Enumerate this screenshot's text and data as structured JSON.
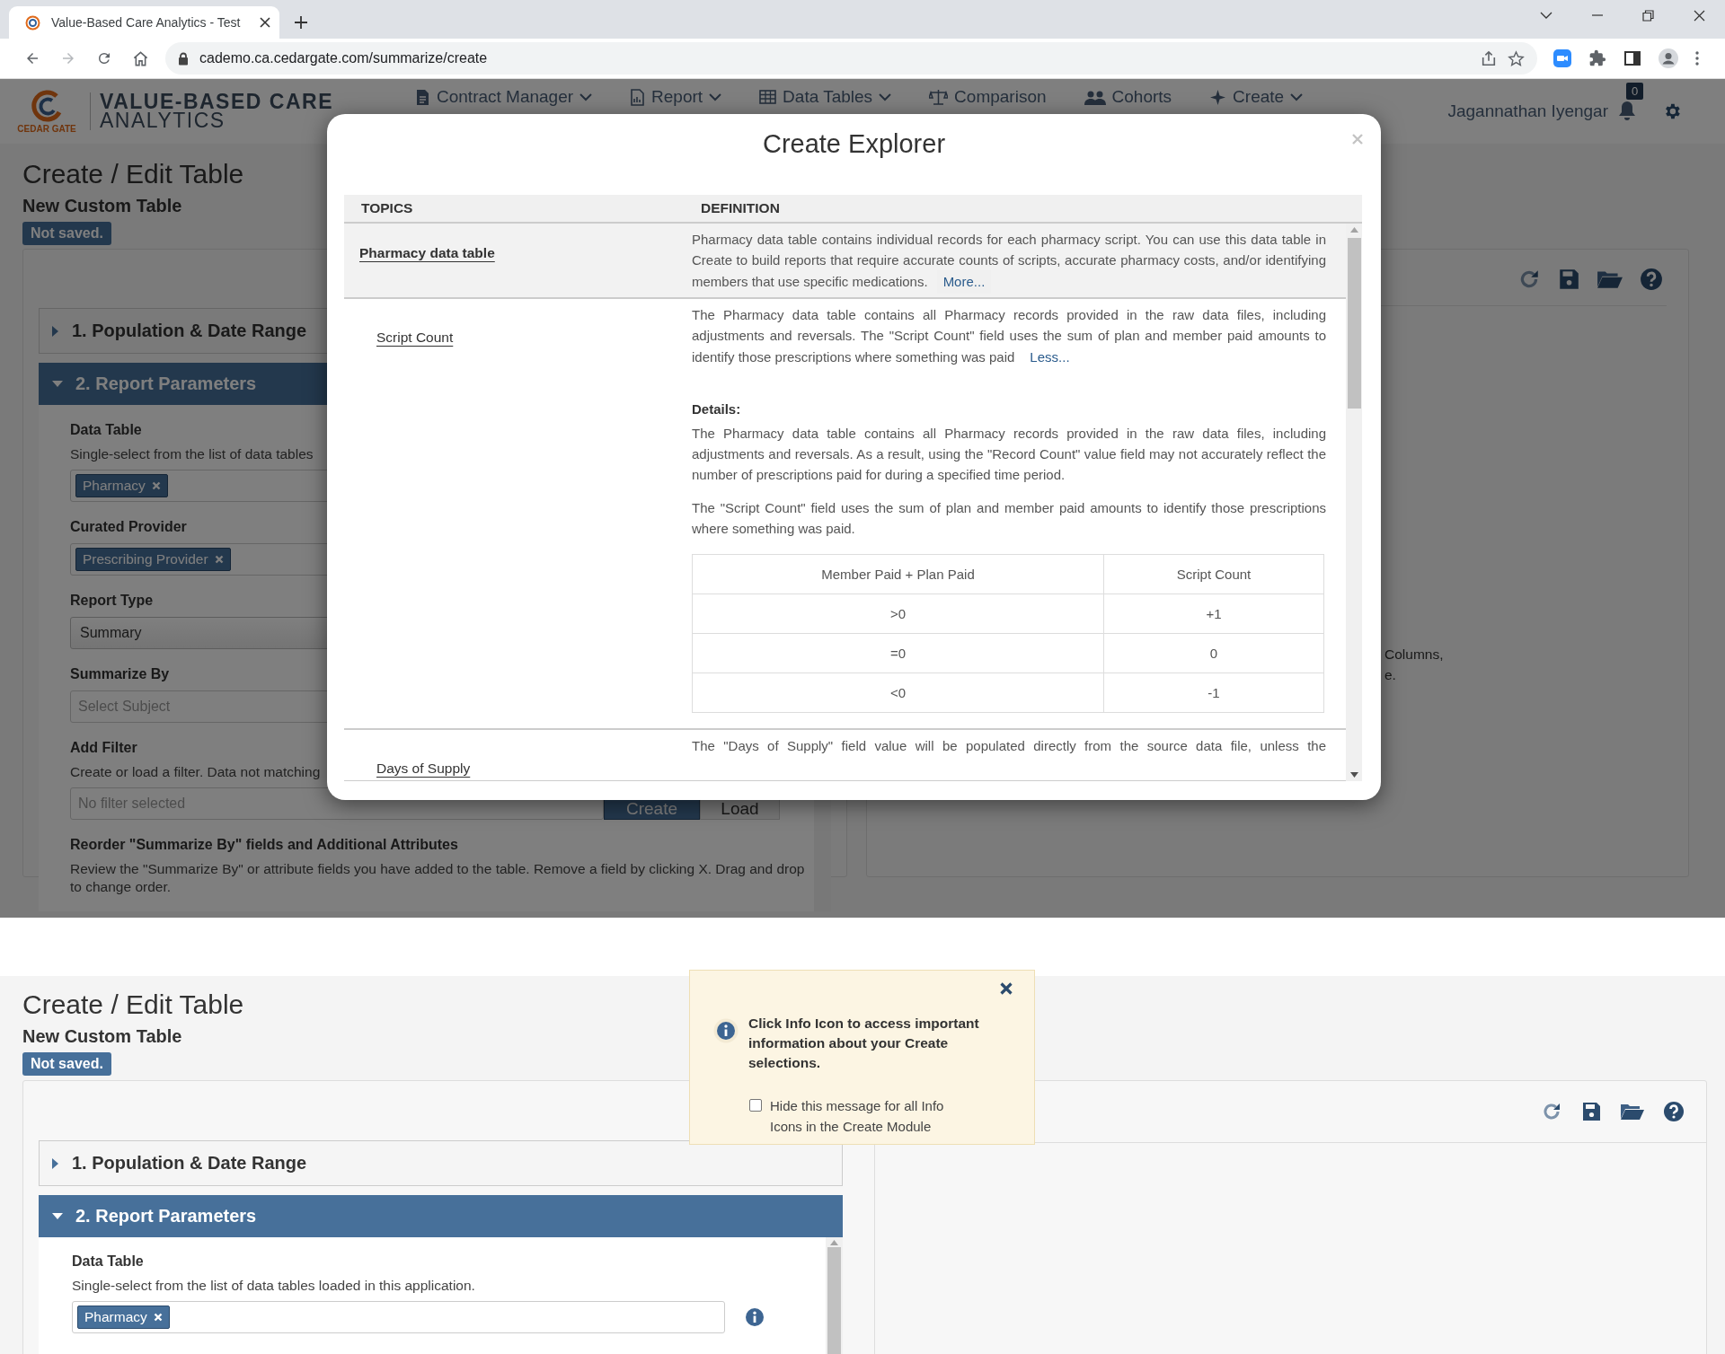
{
  "browser": {
    "tab_title": "Value-Based Care Analytics - Test",
    "url": "cademo.ca.cedargate.com/summarize/create"
  },
  "top_screen": {
    "header": {
      "logo_caption": "CEDAR GATE",
      "brand": [
        "VALUE-BASED CARE",
        "ANALYTICS"
      ],
      "nav": [
        {
          "label": "Contract Manager",
          "has_menu": true
        },
        {
          "label": "Report",
          "has_menu": true
        },
        {
          "label": "Data Tables",
          "has_menu": true
        },
        {
          "label": "Comparison",
          "has_menu": false
        },
        {
          "label": "Cohorts",
          "has_menu": false
        },
        {
          "label": "Create",
          "has_menu": true
        }
      ],
      "user": "Jagannathan Iyengar",
      "notification_count": "0"
    },
    "title": "Create / Edit Table",
    "subtitle": "New Custom Table",
    "status_badge": "Not saved.",
    "sections": [
      {
        "label": "1. Population & Date Range",
        "expanded": false
      },
      {
        "label": "2. Report Parameters",
        "expanded": true
      }
    ],
    "fields": [
      {
        "kind": "tags",
        "label": "Data Table",
        "description": "Single-select from the list of data tables",
        "tags": [
          "Pharmacy"
        ]
      },
      {
        "kind": "tags",
        "label": "Curated Provider",
        "tags": [
          "Prescribing Provider"
        ]
      },
      {
        "kind": "select",
        "label": "Report Type",
        "value": "Summary"
      },
      {
        "kind": "input",
        "label": "Summarize By",
        "placeholder": "Select Subject"
      },
      {
        "kind": "filter",
        "label": "Add Filter",
        "description": "Create or load a filter. Data not matching",
        "placeholder": "No filter selected",
        "buttons": [
          "Create",
          "Load"
        ]
      },
      {
        "kind": "text",
        "label": "Reorder \"Summarize By\" fields and Additional Attributes",
        "description": "Review the \"Summarize By\" or attribute fields you have added to the table. Remove a field by clicking X. Drag and drop to change order."
      }
    ],
    "right_text": [
      "Columns,",
      "e."
    ]
  },
  "modal": {
    "title": "Create Explorer",
    "columns": [
      "TOPICS",
      "DEFINITION"
    ],
    "rows": [
      {
        "kind": "table",
        "topic": "Pharmacy data table",
        "selected": true,
        "definition": "Pharmacy data table contains individual records for each pharmacy script. You can use this data table in Create to build reports that require accurate counts of scripts, accurate pharmacy costs, and/or identifying members that use specific medications.",
        "link": "More..."
      },
      {
        "kind": "field",
        "topic": "Script Count",
        "selected": false,
        "definition": "The Pharmacy data table contains all Pharmacy records provided in the raw data files, including adjustments and reversals. The \"Script Count\" field uses the sum of plan and member paid amounts to identify those prescriptions where something was paid",
        "link": "Less...",
        "details_title": "Details:",
        "details": [
          "The Pharmacy data table contains all Pharmacy records provided in the raw data files, including adjustments and reversals. As a result, using the \"Record Count\" value field may not accurately reflect the number of prescriptions paid for during a specified time period.",
          "The \"Script Count\" field uses the sum of plan and member paid amounts to identify those prescriptions where something was paid."
        ],
        "mapping": {
          "columns": [
            "Member Paid + Plan Paid",
            "Script Count"
          ],
          "rows": [
            [
              ">0",
              "+1"
            ],
            [
              "=0",
              "0"
            ],
            [
              "<0",
              "-1"
            ]
          ]
        }
      },
      {
        "kind": "field",
        "topic": "Days of Supply",
        "selected": false,
        "definition": "The \"Days of Supply\" field value will be populated directly from the source data file, unless the"
      }
    ]
  },
  "bottom_screen": {
    "title": "Create / Edit Table",
    "subtitle": "New Custom Table",
    "status_badge": "Not saved.",
    "sections": [
      {
        "label": "1. Population & Date Range",
        "expanded": false
      },
      {
        "label": "2. Report Parameters",
        "expanded": true
      }
    ],
    "fields": [
      {
        "kind": "tags",
        "label": "Data Table",
        "description": "Single-select from the list of data tables loaded in this application.",
        "tags": [
          "Pharmacy"
        ],
        "info_icon": true
      }
    ],
    "info_popup": {
      "message": "Click Info Icon to access important information about your Create selections.",
      "checkbox_label": "Hide this message for all Info Icons in the Create Module",
      "checked": false
    }
  }
}
